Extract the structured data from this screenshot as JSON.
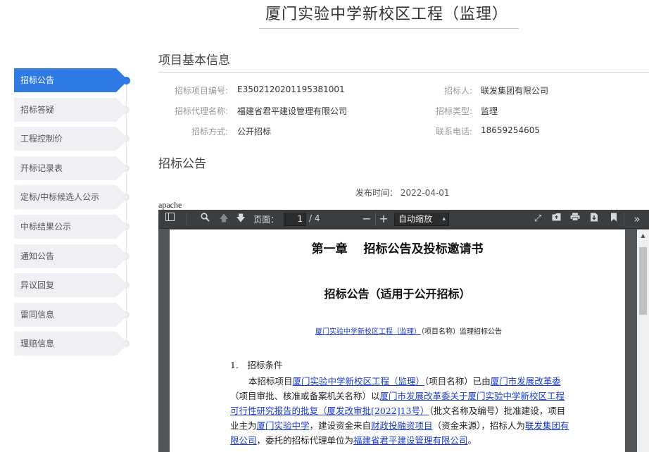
{
  "header": {
    "title": "厦门实验中学新校区工程（监理）"
  },
  "steps": [
    {
      "label": "招标公告"
    },
    {
      "label": "招标答疑"
    },
    {
      "label": "工程控制价"
    },
    {
      "label": "开标记录表"
    },
    {
      "label": "定标/中标候选人公示"
    },
    {
      "label": "中标结果公示"
    },
    {
      "label": "通知公告"
    },
    {
      "label": "异议回复"
    },
    {
      "label": "雷同信息"
    },
    {
      "label": "理赔信息"
    }
  ],
  "info": {
    "heading": "项目基本信息",
    "project_no_label": "招标项目编号:",
    "project_no": "E3502120201195381001",
    "tenderer_label": "招标人:",
    "tenderer": "联发集团有限公司",
    "agency_label": "招标代理名称:",
    "agency": "福建省君平建设管理有限公司",
    "type_label": "招标类型:",
    "type": "监理",
    "method_label": "招标方式:",
    "method": "公开招标",
    "phone_label": "联系电话:",
    "phone": "18659254605"
  },
  "notice": {
    "heading": "招标公告",
    "publish_time": "发布时间： 2022-04-01"
  },
  "apache_label": "apache",
  "viewer": {
    "page_label": "页面：",
    "page_current": "1",
    "page_total": "/ 4",
    "zoom": "自动缩放",
    "doc_title": "第一章　 招标公告及投标邀请书",
    "doc_subtitle": "招标公告（适用于公开招标）",
    "sub_project": "厦门实验中学新校区工程（监理）",
    "sub_rest": "（项目名称）监理招标公告",
    "sec1": "1.　招标条件",
    "para": {
      "p1": "本招标项目",
      "l1": "厦门实验中学新校区工程（监理）",
      "p2": "（项目名称）已由",
      "l2": "厦门市发展改革委",
      "p3": "（项目审批、核准或备案机关名称）以",
      "l3": "厦门市发展改革委关于厦门实验中学新校区工程可行性研究报告的批复（厦发改审批[2022]13号）",
      "p4": "（批文名称及编号）批准建设，项目业主为",
      "l4": "厦门实验中学",
      "p5": "，建设资金来自",
      "l5": "财政投融资项目",
      "p6": "（资金来源），招标人为",
      "l6": "联发集团有限公司",
      "p7": "，委托的招标代理单位为",
      "l7": "福建省君平建设管理有限公司",
      "p8": "。"
    }
  }
}
